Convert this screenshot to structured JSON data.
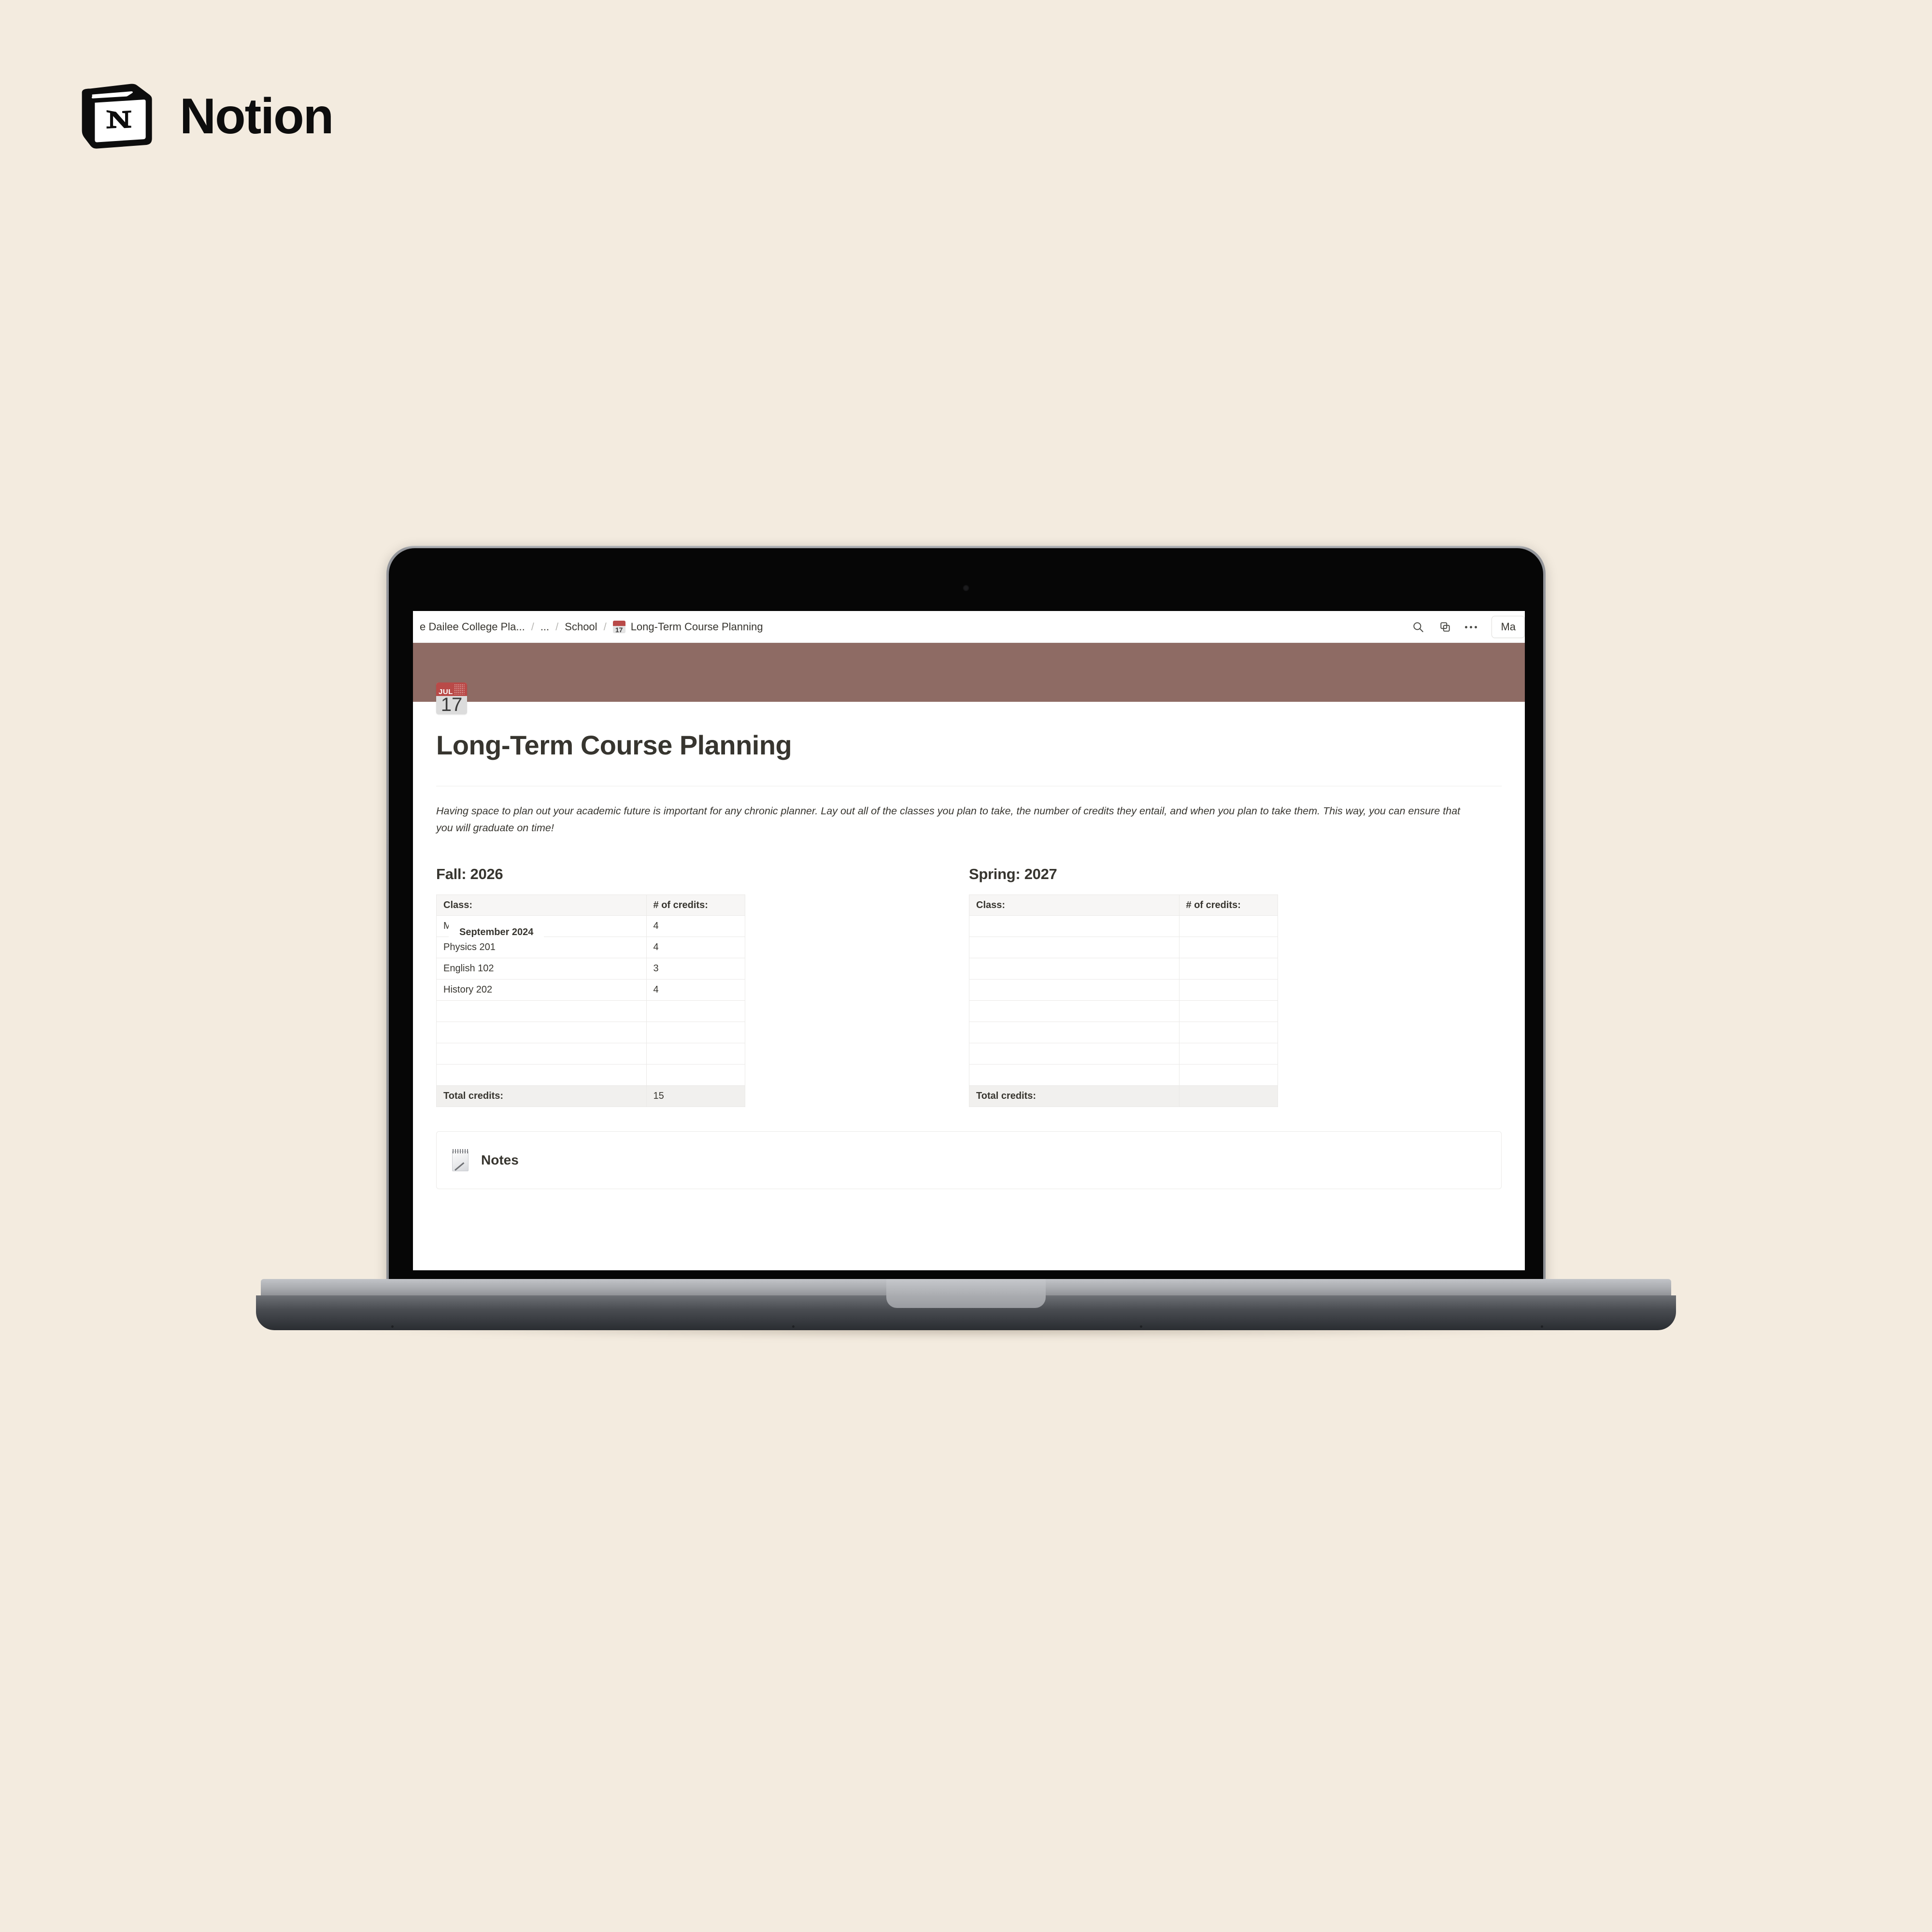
{
  "brand": {
    "name": "Notion",
    "logo_icon": "notion-cube-logo"
  },
  "app": {
    "topbar": {
      "breadcrumb": [
        {
          "label": "e Dailee College Pla...",
          "type": "crumb"
        },
        {
          "label": "/",
          "type": "separator"
        },
        {
          "label": "...",
          "type": "crumb"
        },
        {
          "label": "/",
          "type": "separator"
        },
        {
          "label": "School",
          "type": "crumb"
        },
        {
          "label": "/",
          "type": "separator"
        }
      ],
      "current_page": {
        "icon": "calendar-emoji",
        "icon_month": "JUL",
        "icon_day": "17",
        "label": "Long-Term Course Planning"
      },
      "actions": {
        "search_icon": "search-icon",
        "duplicate_icon": "duplicate-icon",
        "more_icon": "more-options-icon",
        "make_copy_label": "Ma"
      }
    },
    "cover": {
      "color": "#8e6b64"
    },
    "page": {
      "icon": "calendar-emoji",
      "icon_month": "JUL",
      "icon_day": "17",
      "title": "Long-Term Course Planning",
      "description": "Having space to plan out your academic future is important for any chronic planner. Lay out all of the classes you plan to take, the number of credits they entail, and when you plan to take them. This way, you can ensure that you will graduate on time!"
    },
    "overlay_popover": {
      "text": "September 2024"
    },
    "notes": {
      "emoji": "notepad-emoji",
      "label": "Notes"
    }
  },
  "chart_data": [
    {
      "type": "table",
      "title": "Fall: 2026",
      "columns": [
        "Class:",
        "# of credits:"
      ],
      "rows": [
        [
          "Ma",
          "4"
        ],
        [
          "Physics 201",
          "4"
        ],
        [
          "English 102",
          "3"
        ],
        [
          "History 202",
          "4"
        ],
        [
          "",
          ""
        ],
        [
          "",
          ""
        ],
        [
          "",
          ""
        ],
        [
          "",
          ""
        ]
      ],
      "footer": {
        "label": "Total credits:",
        "value": "15"
      }
    },
    {
      "type": "table",
      "title": "Spring: 2027",
      "columns": [
        "Class:",
        "# of credits:"
      ],
      "rows": [
        [
          "",
          ""
        ],
        [
          "",
          ""
        ],
        [
          "",
          ""
        ],
        [
          "",
          ""
        ],
        [
          "",
          ""
        ],
        [
          "",
          ""
        ],
        [
          "",
          ""
        ],
        [
          "",
          ""
        ]
      ],
      "footer": {
        "label": "Total credits:",
        "value": ""
      }
    }
  ]
}
